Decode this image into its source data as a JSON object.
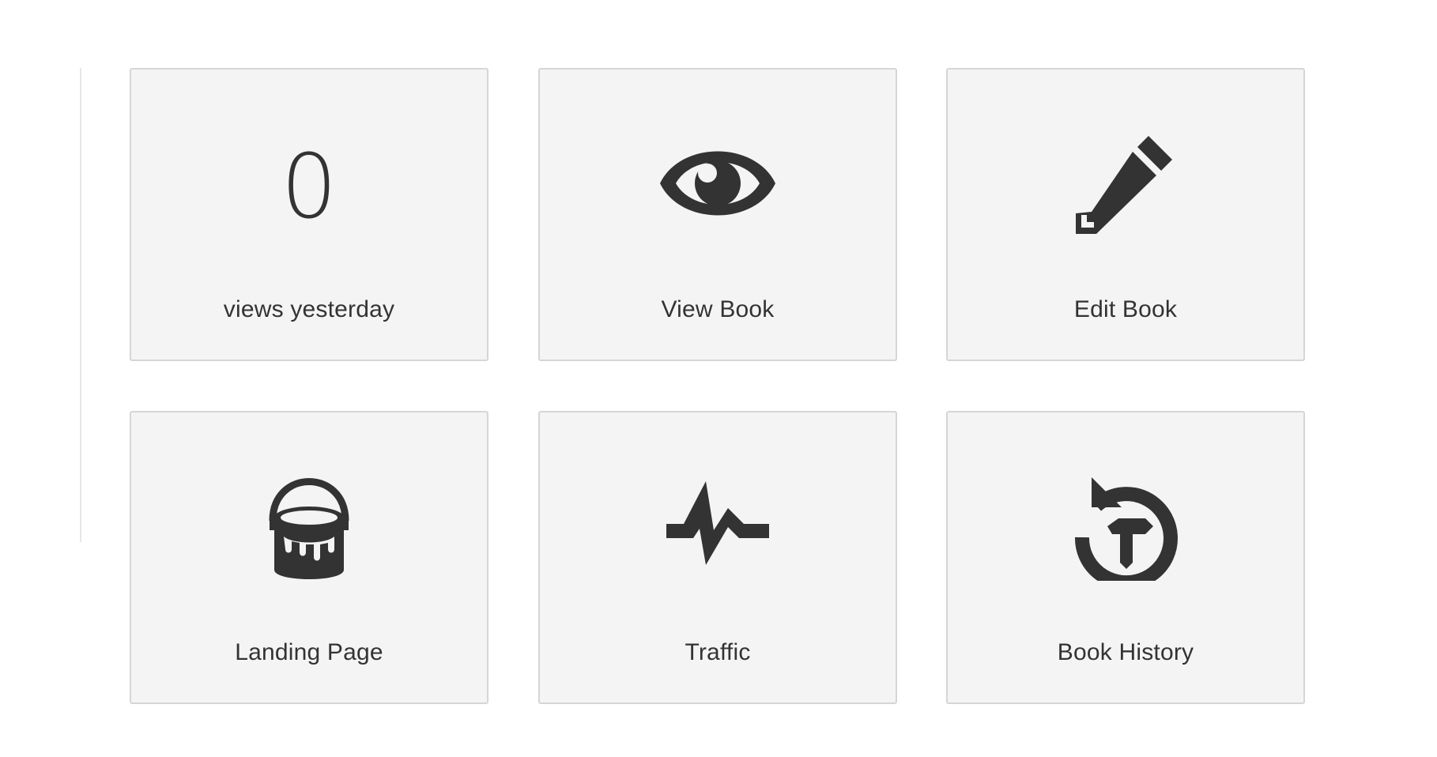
{
  "tiles": [
    {
      "value": "0",
      "label": "views yesterday"
    },
    {
      "icon": "eye-icon",
      "label": "View Book"
    },
    {
      "icon": "pencil-icon",
      "label": "Edit Book"
    },
    {
      "icon": "paint-bucket-icon",
      "label": "Landing Page"
    },
    {
      "icon": "pulse-icon",
      "label": "Traffic"
    },
    {
      "icon": "history-icon",
      "label": "Book History"
    }
  ],
  "colors": {
    "icon": "#333333",
    "tile_background": "#f4f4f4",
    "tile_border": "#d6d6d6",
    "divider": "#e6e6e6"
  }
}
